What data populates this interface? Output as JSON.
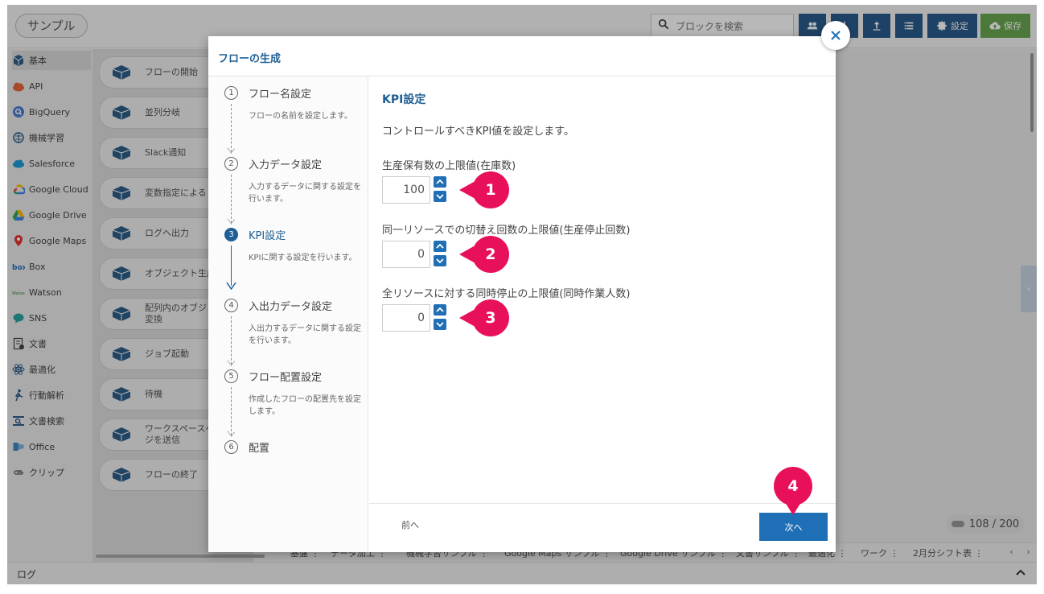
{
  "app": {
    "title": "サンプル"
  },
  "toolbar": {
    "search_placeholder": "ブロックを検索",
    "settings_label": "設定",
    "save_label": "保存",
    "save_color": "#6aa84f",
    "button_color": "#2a5c8c"
  },
  "sidebar": {
    "items": [
      {
        "label": "基本",
        "icon": "cube-icon"
      },
      {
        "label": "API",
        "icon": "api-icon"
      },
      {
        "label": "BigQuery",
        "icon": "bigquery-icon"
      },
      {
        "label": "機械学習",
        "icon": "brain-icon"
      },
      {
        "label": "Salesforce",
        "icon": "salesforce-cloud-icon"
      },
      {
        "label": "Google Cloud",
        "icon": "google-cloud-icon"
      },
      {
        "label": "Google Drive",
        "icon": "google-drive-icon"
      },
      {
        "label": "Google Maps",
        "icon": "map-pin-icon"
      },
      {
        "label": "Box",
        "icon": "box-icon"
      },
      {
        "label": "Watson",
        "icon": "watson-icon"
      },
      {
        "label": "SNS",
        "icon": "chat-bubble-icon"
      },
      {
        "label": "文書",
        "icon": "document-icon"
      },
      {
        "label": "最適化",
        "icon": "atom-icon"
      },
      {
        "label": "行動解析",
        "icon": "person-motion-icon"
      },
      {
        "label": "文書検索",
        "icon": "document-search-icon"
      },
      {
        "label": "Office",
        "icon": "office-icon"
      },
      {
        "label": "クリップ",
        "icon": "paperclip-icon"
      }
    ]
  },
  "blocks": {
    "items": [
      {
        "label": "フローの開始"
      },
      {
        "label": "並列分岐"
      },
      {
        "label": "Slack通知"
      },
      {
        "label": "変数指定による S"
      },
      {
        "label": "ログへ出力"
      },
      {
        "label": "オブジェクト生成"
      },
      {
        "label": "配列内のオブジェ\n変換"
      },
      {
        "label": "ジョブ起動"
      },
      {
        "label": "待機"
      },
      {
        "label": "ワークスペースへ\nジを送信"
      },
      {
        "label": "フローの終了"
      }
    ]
  },
  "canvas": {
    "count": "108 / 200",
    "tabs": [
      "基盤 ⋮",
      "データ加工 ⋮",
      "機械学習サンプル ⋮",
      "Google Maps サンプル ⋮",
      "Google Drive サンプル ⋮",
      "文書サンプル ⋮",
      "最適化 ⋮",
      "ワーク ⋮",
      "2月分シフト表 ⋮"
    ]
  },
  "log": {
    "label": "ログ"
  },
  "modal": {
    "title": "フローの生成",
    "steps": [
      {
        "num": "1",
        "title": "フロー名設定",
        "desc": "フローの名前を設定します。"
      },
      {
        "num": "2",
        "title": "入力データ設定",
        "desc": "入力するデータに関する設定を行います。"
      },
      {
        "num": "3",
        "title": "KPI設定",
        "desc": "KPIに関する設定を行います。"
      },
      {
        "num": "4",
        "title": "入出力データ設定",
        "desc": "入出力するデータに関する設定を行います。"
      },
      {
        "num": "5",
        "title": "フロー配置設定",
        "desc": "作成したフローの配置先を設定します。"
      },
      {
        "num": "6",
        "title": "配置",
        "desc": ""
      }
    ],
    "content": {
      "title": "KPI設定",
      "description": "コントロールすべきKPI値を設定します。",
      "fields": [
        {
          "label": "生産保有数の上限値(在庫数)",
          "value": "100",
          "marker": "1"
        },
        {
          "label": "同一リソースでの切替え回数の上限値(生産停止回数)",
          "value": "0",
          "marker": "2"
        },
        {
          "label": "全リソースに対する同時停止の上限値(同時作業人数)",
          "value": "0",
          "marker": "3"
        }
      ]
    },
    "footer": {
      "prev_label": "前へ",
      "next_label": "次へ",
      "next_marker": "4"
    },
    "accent_color": "#1e5f95",
    "marker_color": "#e8105a"
  }
}
